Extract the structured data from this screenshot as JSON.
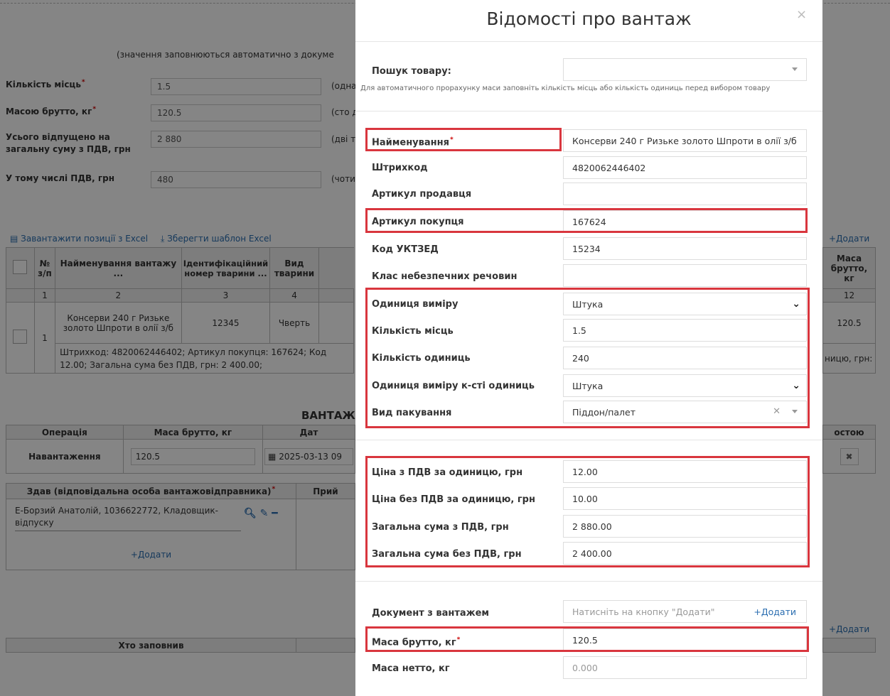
{
  "bg": {
    "auto_note": "(значення заповнюються автоматично з докуме",
    "fields": [
      {
        "label": "Кількість місць",
        "required": true,
        "value": "1.5",
        "words": "(одна"
      },
      {
        "label": "Масою брутто, кг",
        "required": true,
        "value": "120.5",
        "words": "(сто д"
      },
      {
        "label": "Усього відпущено на загальну суму з ПДВ, грн",
        "required": false,
        "value": "2 880",
        "words": "(дві т"
      },
      {
        "label": "У тому числі ПДВ, грн",
        "required": false,
        "value": "480",
        "words": "(чоти"
      }
    ],
    "excel_load": "Завантажити позиції з Excel",
    "excel_save": "Зберегти шаблон Excel",
    "add": "Додати",
    "table": {
      "headers": [
        "№ з/п",
        "Найменування вантажу ...",
        "Ідентифікаційний номер тварини ...",
        "Вид тварини"
      ],
      "nums": [
        "1",
        "2",
        "3",
        "4"
      ],
      "right_header": "Маса брутто, кг",
      "right_num": "12",
      "row": {
        "n": "1",
        "name": "Консерви 240 г Ризьке золото Шпроти в олії з/б",
        "id": "12345",
        "kind": "Чверть",
        "mass": "120.5"
      },
      "details": "Штрихкод: 4820062446402; Артикул покупця: 167624; Код",
      "details2": "12.00; Загальна сума без ПДВ, грн: 2 400.00;",
      "details_right": "ницю, грн:"
    },
    "section_title": "ВАНТАЖ",
    "ops": {
      "headers": [
        "Операція",
        "Маса брутто, кг",
        "Дат"
      ],
      "right_header": "остою",
      "row": {
        "op": "Навантаження",
        "mass": "120.5",
        "date": "2025-03-13 09"
      }
    },
    "resp": {
      "header": "Здав (відповідальна особа вантажовідправника)",
      "header2": "Прий",
      "person": "Е-Борзий Анатолій, 1036622772, Кладовщик-відпуску",
      "add": "Додати"
    },
    "filled_by": "Хто заповнив"
  },
  "modal": {
    "title": "Відомості про вантаж",
    "close": "×",
    "search_label": "Пошук товару:",
    "search_hint": "Для автоматичного прорахунку маси заповніть кількість місць або кількість одиниць перед вибором товару",
    "fields": {
      "name": {
        "label": "Найменування",
        "value": "Консерви 240 г Ризьке золото Шпроти в олії з/б"
      },
      "barcode": {
        "label": "Штрихкод",
        "value": "4820062446402"
      },
      "seller_sku": {
        "label": "Артикул продавця",
        "value": ""
      },
      "buyer_sku": {
        "label": "Артикул покупця",
        "value": "167624"
      },
      "uktzed": {
        "label": "Код УКТЗЕД",
        "value": "15234"
      },
      "hazard": {
        "label": "Клас небезпечних речовин",
        "value": ""
      },
      "unit": {
        "label": "Одиниця виміру",
        "value": "Штука"
      },
      "places": {
        "label": "Кількість місць",
        "value": "1.5"
      },
      "units_qty": {
        "label": "Кількість одиниць",
        "value": "240"
      },
      "unit_qty_unit": {
        "label": "Одиниця виміру к-сті одиниць",
        "value": "Штука"
      },
      "packaging": {
        "label": "Вид пакування",
        "value": "Піддон/палет"
      },
      "price_vat": {
        "label": "Ціна з ПДВ за одиницю, грн",
        "value": "12.00"
      },
      "price_novat": {
        "label": "Ціна без ПДВ за одиницю, грн",
        "value": "10.00"
      },
      "total_vat": {
        "label": "Загальна сума з ПДВ, грн",
        "value": "2 880.00"
      },
      "total_novat": {
        "label": "Загальна сума без ПДВ, грн",
        "value": "2 400.00"
      },
      "doc": {
        "label": "Документ з вантажем",
        "placeholder": "Натисніть на кнопку \"Додати\"",
        "add": "Додати"
      },
      "gross": {
        "label": "Маса брутто, кг",
        "value": "120.5"
      },
      "net": {
        "label": "Маса нетто, кг",
        "value": "0.000"
      }
    }
  },
  "colors": {
    "highlight": "#d9363e",
    "link": "#2a6db0"
  }
}
